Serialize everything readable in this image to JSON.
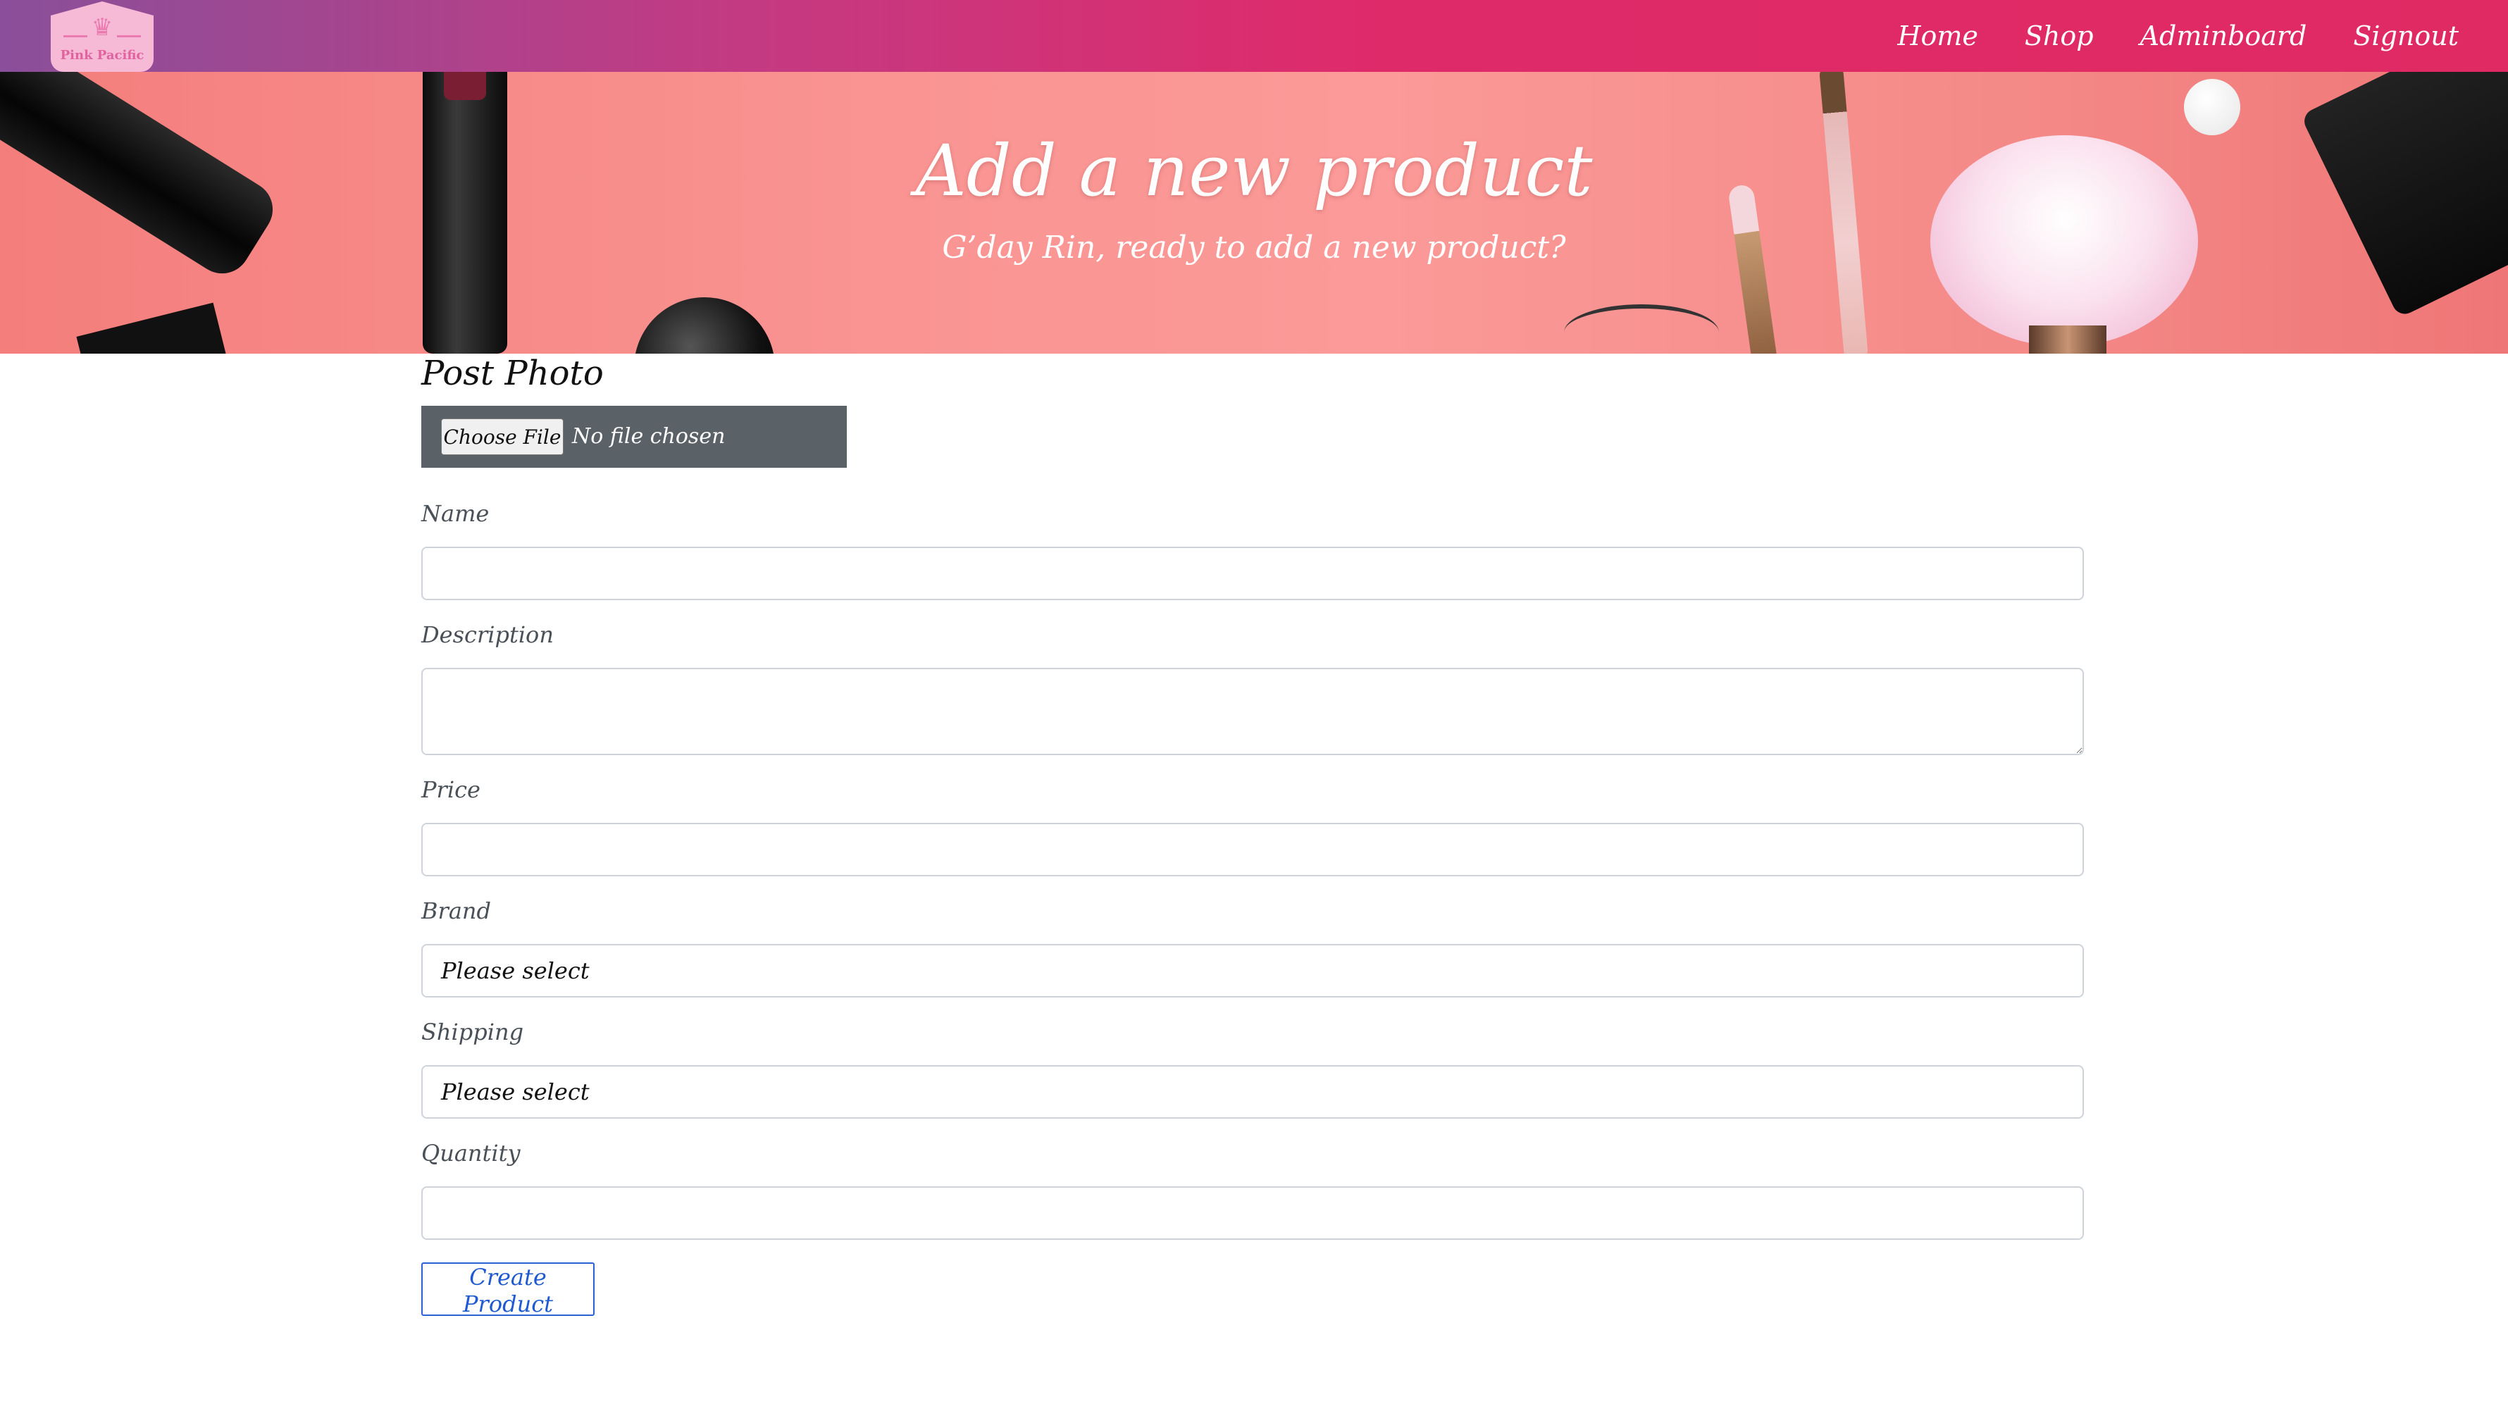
{
  "brand": {
    "logo_text": "Pink Pacific",
    "logo_icon": "crown-icon"
  },
  "nav": {
    "items": [
      {
        "label": "Home"
      },
      {
        "label": "Shop"
      },
      {
        "label": "Adminboard"
      },
      {
        "label": "Signout"
      }
    ]
  },
  "hero": {
    "title": "Add a new product",
    "subtitle": "G’day Rin, ready to add a new product?"
  },
  "form": {
    "photo_label": "Post Photo",
    "file_button": "Choose File",
    "file_status": "No file chosen",
    "fields": {
      "name": {
        "label": "Name",
        "value": ""
      },
      "description": {
        "label": "Description",
        "value": ""
      },
      "price": {
        "label": "Price",
        "value": ""
      },
      "brand": {
        "label": "Brand",
        "selected": "Please select"
      },
      "shipping": {
        "label": "Shipping",
        "selected": "Please select"
      },
      "quantity": {
        "label": "Quantity",
        "value": ""
      }
    },
    "submit_label": "Create Product"
  },
  "colors": {
    "navbar_start": "#8a4f9a",
    "navbar_end": "#e02a64",
    "hero_bg": "#fb9a98",
    "file_box_bg": "#5a6268",
    "submit_border": "#2a62d6"
  }
}
